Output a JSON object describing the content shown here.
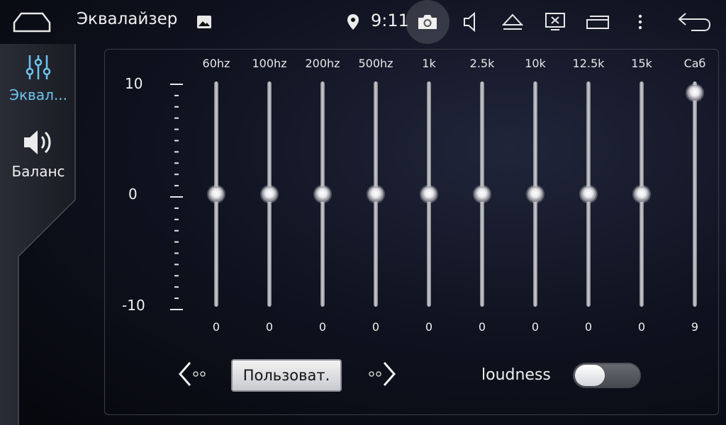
{
  "statusbar": {
    "title": "Эквалайзер",
    "time": "9:11",
    "icons": [
      "home-icon",
      "image-icon",
      "location-icon",
      "camera-icon",
      "volume-icon",
      "eject-icon",
      "screen-off-icon",
      "windows-icon",
      "more-icon",
      "back-icon"
    ]
  },
  "sidebar": {
    "items": [
      {
        "label": "Эквал...",
        "icon": "equalizer-icon",
        "active": true
      },
      {
        "label": "Баланс",
        "icon": "speaker-icon",
        "active": false
      }
    ]
  },
  "scale": {
    "max": "10",
    "mid": "0",
    "min": "-10"
  },
  "bands": [
    {
      "label": "60hz",
      "value": "0",
      "level": 0
    },
    {
      "label": "100hz",
      "value": "0",
      "level": 0
    },
    {
      "label": "200hz",
      "value": "0",
      "level": 0
    },
    {
      "label": "500hz",
      "value": "0",
      "level": 0
    },
    {
      "label": "1k",
      "value": "0",
      "level": 0
    },
    {
      "label": "2.5k",
      "value": "0",
      "level": 0
    },
    {
      "label": "10k",
      "value": "0",
      "level": 0
    },
    {
      "label": "12.5k",
      "value": "0",
      "level": 0
    },
    {
      "label": "15k",
      "value": "0",
      "level": 0
    },
    {
      "label": "Саб",
      "value": "9",
      "level": 9
    }
  ],
  "controls": {
    "preset_label": "Пользоват.",
    "loudness_label": "loudness",
    "loudness_on": false
  },
  "colors": {
    "accent": "#6ec4f0",
    "background": "#0b0d14"
  }
}
